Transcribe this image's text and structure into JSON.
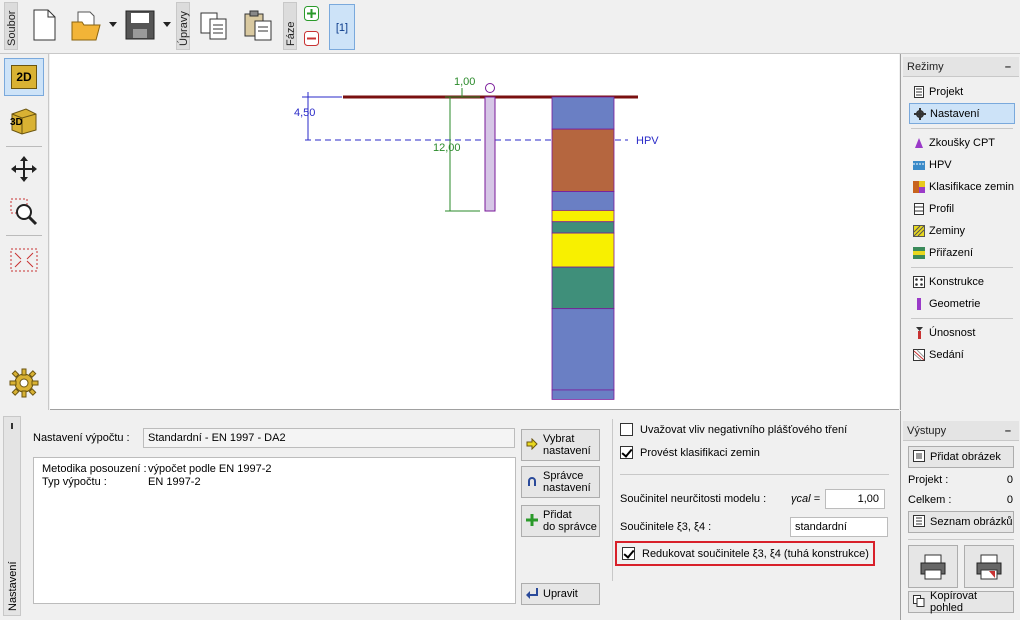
{
  "toolbar": {
    "file_label": "Soubor",
    "edit_label": "Úpravy",
    "phase_label": "Fáze",
    "phase_value": "[1]"
  },
  "left_tools": {
    "view_2d": "2D",
    "view_3d": "3D"
  },
  "drawing": {
    "dim_top": "1,00",
    "dim_left": "4,50",
    "dim_depth": "12,00",
    "hpv_label": "HPV",
    "layers": [
      {
        "color": "#6a7fc4",
        "from": 0,
        "to": 1.7
      },
      {
        "color": "#b5663f",
        "from": 1.7,
        "to": 5.0
      },
      {
        "color": "#6a7fc4",
        "from": 5.0,
        "to": 6.0
      },
      {
        "color": "#f8f000",
        "from": 6.0,
        "to": 6.6
      },
      {
        "color": "#3f8f7a",
        "from": 6.6,
        "to": 7.2
      },
      {
        "color": "#f8f000",
        "from": 7.2,
        "to": 9.0
      },
      {
        "color": "#3f8f7a",
        "from": 9.0,
        "to": 11.2
      },
      {
        "color": "#6a7fc4",
        "from": 11.2,
        "to": 15.5
      },
      {
        "color": "#6a7fc4",
        "from": 15.5,
        "to": 16.0
      }
    ]
  },
  "modes": {
    "title": "Režimy",
    "collapse": "–",
    "items": [
      {
        "label": "Projekt",
        "icon": "document-icon"
      },
      {
        "label": "Nastavení",
        "icon": "gear-icon",
        "active": true
      },
      {
        "label": "Zkoušky CPT",
        "icon": "cpt-icon"
      },
      {
        "label": "HPV",
        "icon": "water-table-icon"
      },
      {
        "label": "Klasifikace zemin",
        "icon": "soil-classification-icon"
      },
      {
        "label": "Profil",
        "icon": "profile-icon"
      },
      {
        "label": "Zeminy",
        "icon": "soils-icon"
      },
      {
        "label": "Přiřazení",
        "icon": "assign-icon"
      },
      {
        "label": "Konstrukce",
        "icon": "construction-icon"
      },
      {
        "label": "Geometrie",
        "icon": "geometry-icon"
      },
      {
        "label": "Únosnost",
        "icon": "bearing-capacity-icon"
      },
      {
        "label": "Sedání",
        "icon": "settlement-icon"
      }
    ]
  },
  "settings": {
    "tab_label": "Nastavení",
    "calc_label": "Nastavení výpočtu :",
    "calc_value": "Standardní - EN 1997 - DA2",
    "method_key": "Metodika posouzení :",
    "method_val": "výpočet podle EN 1997-2",
    "type_key": "Typ výpočtu :",
    "type_val": "EN 1997-2",
    "btn_select_1": "Vybrat",
    "btn_select_2": "nastavení",
    "btn_manager_1": "Správce",
    "btn_manager_2": "nastavení",
    "btn_add_1": "Přidat",
    "btn_add_2": "do správce",
    "btn_edit": "Upravit",
    "chk_negative": "Uvažovat vliv negativního plášťového tření",
    "chk_negative_on": false,
    "chk_classify": "Provést klasifikaci zemin",
    "chk_classify_on": true,
    "model_label": "Součinitel neurčitosti modelu :",
    "gamma_label": "γcal =",
    "gamma_value": "1,00",
    "xi_label": "Součinitele ξ3, ξ4 :",
    "xi_value": "standardní",
    "reduce_label": "Redukovat součinitele ξ3, ξ4 (tuhá  konstrukce)",
    "reduce_on": true
  },
  "outputs": {
    "title": "Výstupy",
    "collapse": "–",
    "add_image": "Přidat obrázek",
    "project_label": "Projekt :",
    "project_count": "0",
    "total_label": "Celkem :",
    "total_count": "0",
    "list_images": "Seznam obrázků",
    "copy_view": "Kopírovat pohled"
  }
}
